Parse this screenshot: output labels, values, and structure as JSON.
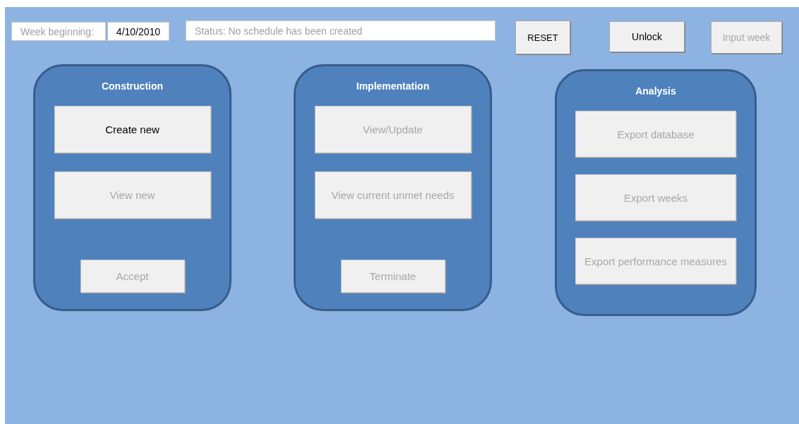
{
  "header": {
    "week_label": "Week beginning:",
    "week_value": "4/10/2010",
    "status": "Status: No schedule has been created",
    "buttons": [
      {
        "label": "RESET",
        "disabled": false,
        "kind": "bold"
      },
      {
        "label": "Unlock",
        "disabled": false,
        "kind": "plain"
      },
      {
        "label": "Input week",
        "disabled": true,
        "kind": "plain"
      }
    ]
  },
  "panels": [
    {
      "title": "Construction",
      "buttons": [
        {
          "label": "Create new",
          "disabled": false,
          "kind": "large"
        },
        {
          "label": "View new",
          "disabled": true,
          "kind": "large"
        },
        {
          "label": "Accept",
          "disabled": true,
          "kind": "small"
        }
      ]
    },
    {
      "title": "Implementation",
      "buttons": [
        {
          "label": "View/Update",
          "disabled": true,
          "kind": "large"
        },
        {
          "label": "View current unmet needs",
          "disabled": true,
          "kind": "large"
        },
        {
          "label": "Terminate",
          "disabled": true,
          "kind": "small"
        }
      ]
    },
    {
      "title": "Analysis",
      "buttons": [
        {
          "label": "Export database",
          "disabled": true,
          "kind": "large"
        },
        {
          "label": "Export weeks",
          "disabled": true,
          "kind": "large"
        },
        {
          "label": "Export performance measures",
          "disabled": true,
          "kind": "large"
        }
      ]
    }
  ]
}
